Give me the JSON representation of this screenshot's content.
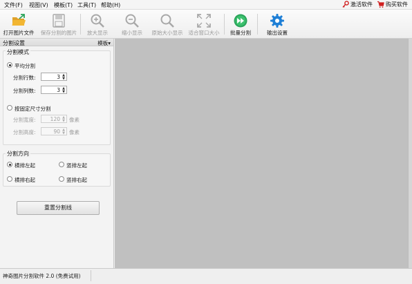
{
  "menubar": {
    "items": [
      "文件(F)",
      "视图(V)",
      "模板(T)",
      "工具(T)",
      "帮助(H)"
    ],
    "activate_label": "激活软件",
    "buy_label": "购买软件"
  },
  "toolbar": {
    "open_file": "打开图片文件",
    "save_split": "保存分割的图片",
    "zoom_in": "放大显示",
    "zoom_out": "缩小显示",
    "original_size": "原始大小显示",
    "fit_window": "适合窗口大小",
    "batch_split": "批量分割",
    "output_settings": "输出设置"
  },
  "panel": {
    "title": "分割设置",
    "template_menu": "模板▾",
    "split_mode": {
      "title": "分割模式",
      "average_label": "平均分割",
      "rows_label": "分割行数:",
      "rows_value": "3",
      "cols_label": "分割列数:",
      "cols_value": "3",
      "fixed_label": "按固定尺寸分割",
      "width_label": "分割宽度:",
      "width_value": "120",
      "height_label": "分割高度:",
      "height_value": "90",
      "unit": "像素"
    },
    "direction": {
      "title": "分割方向",
      "horiz_left": "横排左起",
      "vert_left": "竖排左起",
      "horiz_right": "横排右起",
      "vert_right": "竖排右起"
    },
    "reset_button": "重置分割线"
  },
  "status": {
    "text": "神奇图片分割软件 2.0 (免费试用)"
  },
  "colors": {
    "canvas_bg": "#c0c0c0",
    "folder_icon": "#f2b632",
    "batch_icon": "#2aa35a",
    "gear_icon": "#1e7fd6",
    "key_icon": "#d02020",
    "cart_icon": "#d02020"
  }
}
